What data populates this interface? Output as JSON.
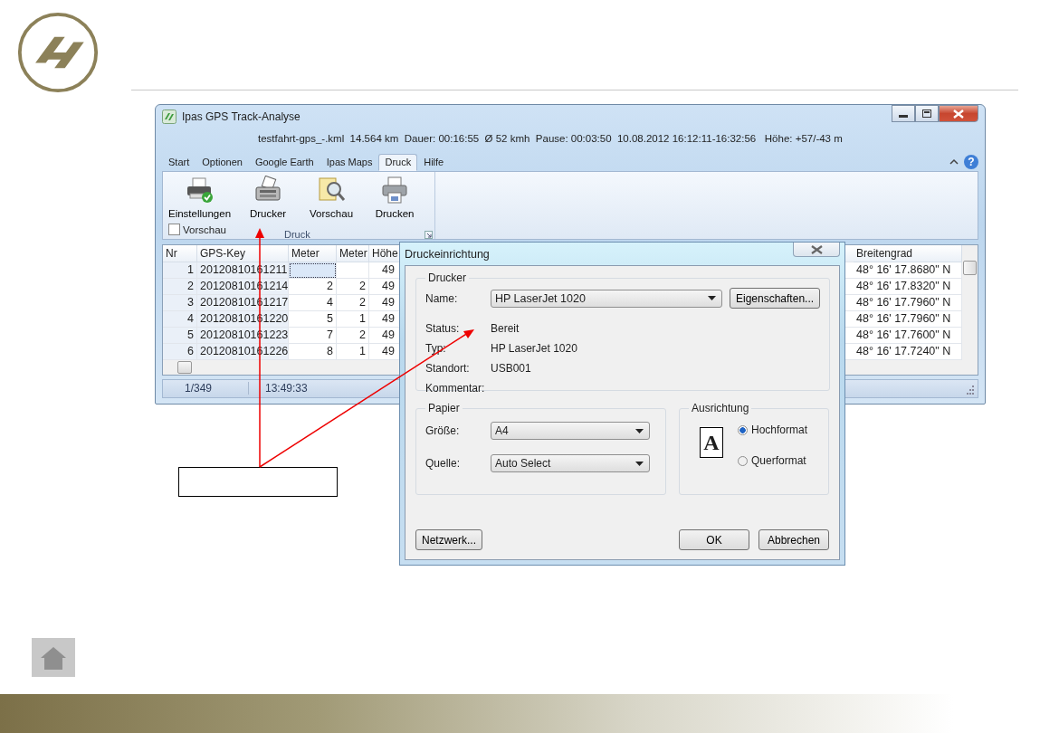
{
  "window": {
    "title": "Ipas GPS Track-Analyse",
    "info": "testfahrt-gps_-.kml  14.564 km  Dauer: 00:16:55  Ø 52 kmh  Pause: 00:03:50  10.08.2012 16:12:11-16:32:56   Höhe: +57/-43 m"
  },
  "ribbon": {
    "tabs": [
      {
        "label": "Start",
        "selected": false
      },
      {
        "label": "Optionen",
        "selected": false
      },
      {
        "label": "Google Earth",
        "selected": false
      },
      {
        "label": "Ipas Maps",
        "selected": false
      },
      {
        "label": "Druck",
        "selected": true
      },
      {
        "label": "Hilfe",
        "selected": false
      }
    ],
    "help_glyph": "?",
    "buttons": [
      {
        "label": "Einstellungen",
        "kind": "settings"
      },
      {
        "label": "Drucker",
        "kind": "printer"
      },
      {
        "label": "Vorschau",
        "kind": "preview"
      },
      {
        "label": "Drucken",
        "kind": "print"
      }
    ],
    "preview_checkbox": {
      "label": "Vorschau",
      "checked": false
    },
    "group_label": "Druck"
  },
  "table": {
    "columns": [
      "Nr",
      "GPS-Key",
      "Meter",
      "Meter",
      "Höhe",
      "Breitengrad"
    ],
    "rows": [
      {
        "selected": true,
        "cells": [
          "1",
          "20120810161211",
          null,
          null,
          "49",
          "48° 16' 17.8680\" N"
        ]
      },
      {
        "selected": false,
        "cells": [
          "2",
          "20120810161214",
          "2",
          "2",
          "49",
          "48° 16' 17.8320\" N"
        ]
      },
      {
        "selected": false,
        "cells": [
          "3",
          "20120810161217",
          "4",
          "2",
          "49",
          "48° 16' 17.7960\" N"
        ]
      },
      {
        "selected": false,
        "cells": [
          "4",
          "20120810161220",
          "5",
          "1",
          "49",
          "48° 16' 17.7960\" N"
        ]
      },
      {
        "selected": false,
        "cells": [
          "5",
          "20120810161223",
          "7",
          "2",
          "49",
          "48° 16' 17.7600\" N"
        ]
      },
      {
        "selected": false,
        "cells": [
          "6",
          "20120810161226",
          "8",
          "1",
          "49",
          "48° 16' 17.7240\" N"
        ]
      }
    ]
  },
  "status_bar": [
    "1/349",
    "13:49:33"
  ],
  "dialog": {
    "title": "Druckeinrichtung",
    "printer_group": {
      "title": "Drucker",
      "name_label": "Name:",
      "name_value": "HP LaserJet 1020",
      "properties_button": "Eigenschaften...",
      "info": [
        {
          "label": "Status:",
          "value": "Bereit"
        },
        {
          "label": "Typ:",
          "value": "HP LaserJet 1020"
        },
        {
          "label": "Standort:",
          "value": "USB001"
        },
        {
          "label": "Kommentar:"
        }
      ]
    },
    "paper_group": {
      "title": "Papier",
      "fields": [
        {
          "label": "Größe:",
          "value": "A4"
        },
        {
          "label": "Quelle:",
          "value": "Auto Select"
        }
      ]
    },
    "orientation_group": {
      "title": "Ausrichtung",
      "glyph": "A",
      "options": [
        {
          "label": "Hochformat",
          "selected": true
        },
        {
          "label": "Querformat",
          "selected": false
        }
      ]
    },
    "buttons": [
      {
        "label": "Netzwerk...",
        "kind": "left"
      },
      {
        "label": "OK",
        "kind": "right"
      },
      {
        "label": "Abbrechen",
        "kind": "right"
      }
    ]
  }
}
